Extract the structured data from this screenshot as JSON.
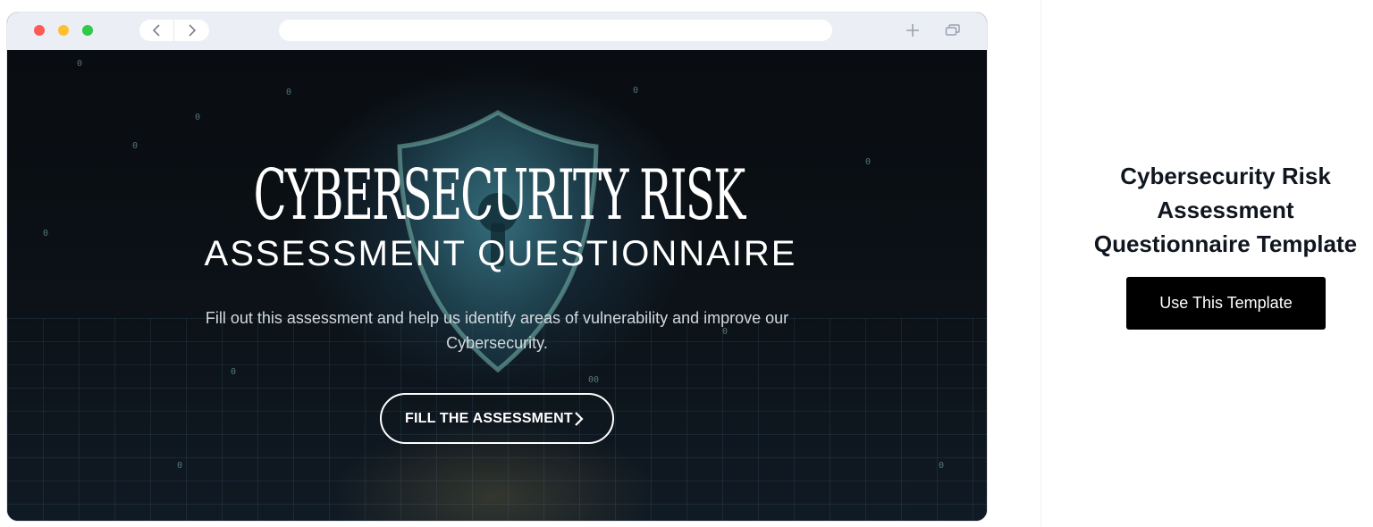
{
  "browser": {
    "window_controls": [
      "close",
      "minimize",
      "maximize"
    ],
    "nav": {
      "back_icon": "chevron-left-icon",
      "forward_icon": "chevron-right-icon"
    },
    "address": "",
    "actions": {
      "new_tab_icon": "plus-icon",
      "tabs_icon": "tabs-icon"
    }
  },
  "hero": {
    "title_line1": "CYBERSECURITY RISK",
    "title_line2": "ASSESSMENT QUESTIONNAIRE",
    "subtitle": "Fill out this assessment and help us identify areas of vulnerability and improve our Cybersecurity.",
    "cta_label": "FILL THE ASSESSMENT",
    "cta_icon": "chevron-right-icon",
    "background_icon": "shield-lock-icon"
  },
  "side": {
    "title": "Cybersecurity Risk Assessment Questionnaire Template",
    "button_label": "Use This Template"
  },
  "colors": {
    "accent_button": "#000000",
    "title_text": "#10161f",
    "chrome": "#ebeef5",
    "close_dot": "#fd5a57",
    "minimize_dot": "#fdc030",
    "maximize_dot": "#30c948"
  }
}
